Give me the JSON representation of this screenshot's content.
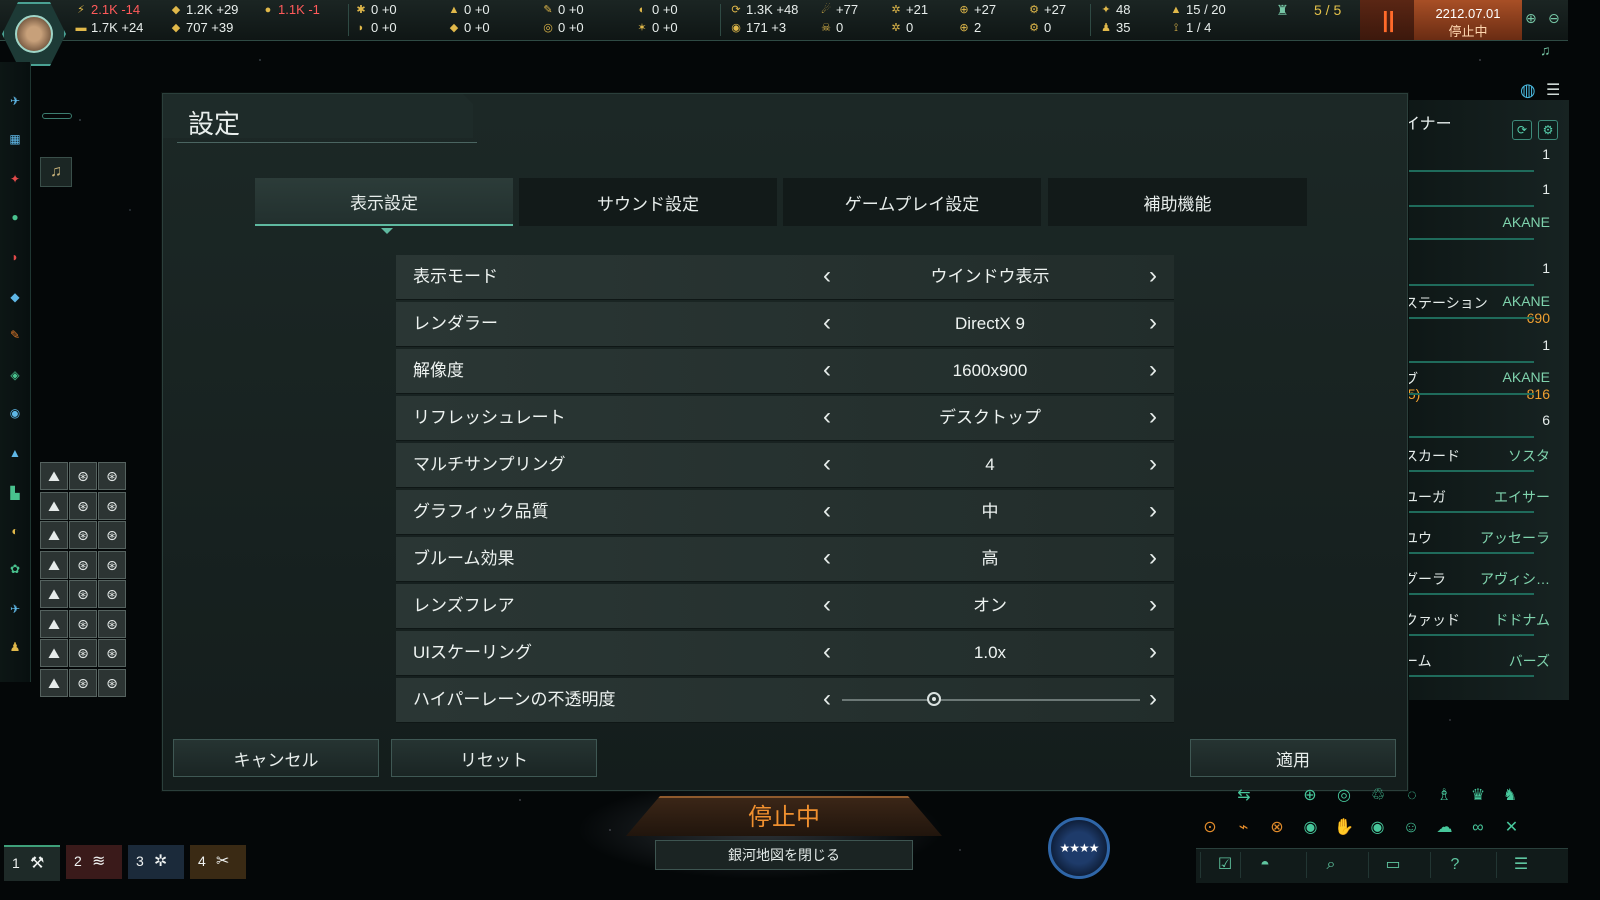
{
  "colors": {
    "accent": "#5fb9a0",
    "energy": "#e0b84a",
    "warning": "#f0902f",
    "negative": "#e24a4a"
  },
  "topbar": {
    "resources_row1": [
      {
        "icon": "energy-icon",
        "glyph": "⚡",
        "text": "2.1K -14",
        "color": "#ff5a5a"
      },
      {
        "icon": "mineral-icon",
        "glyph": "◆",
        "text": "1.2K +29",
        "color": "#e8eeec"
      },
      {
        "icon": "food-icon",
        "glyph": "●",
        "text": "1.1K -1",
        "color": "#ff5a5a"
      },
      {
        "icon": "exotic-gas-icon",
        "glyph": "✱",
        "text": "0 +0",
        "color": "#e8eeec"
      },
      {
        "icon": "crystal-icon",
        "glyph": "▲",
        "text": "0 +0",
        "color": "#e8eeec"
      },
      {
        "icon": "motes-icon",
        "glyph": "✎",
        "text": "0 +0",
        "color": "#e8eeec"
      },
      {
        "icon": "dark-matter-icon",
        "glyph": "◐",
        "text": "0 +0",
        "color": "#e8eeec"
      },
      {
        "icon": "influence-icon",
        "glyph": "⟳",
        "text": "1.3K +48",
        "color": "#e8eeec"
      },
      {
        "icon": "physics-icon",
        "glyph": "☄",
        "text": "+77",
        "color": "#e8eeec"
      },
      {
        "icon": "society-icon",
        "glyph": "✲",
        "text": "+21",
        "color": "#e8eeec"
      },
      {
        "icon": "engineering-icon",
        "glyph": "⊕",
        "text": "+27",
        "color": "#e8eeec"
      },
      {
        "icon": "gear-icon",
        "glyph": "⚙",
        "text": "+27",
        "color": "#e8eeec"
      },
      {
        "icon": "fleet-icon",
        "glyph": "✦",
        "text": "48",
        "color": "#e8eeec"
      },
      {
        "icon": "ship-icon",
        "glyph": "▲",
        "text": "15 / 20",
        "color": "#e8eeec"
      }
    ],
    "resources_row2": [
      {
        "icon": "consumer-goods-icon",
        "glyph": "▬",
        "text": "1.7K +24",
        "color": "#e8eeec"
      },
      {
        "icon": "alloys-icon",
        "glyph": "◆",
        "text": "707 +39",
        "color": "#e8eeec"
      },
      {
        "icon": "nanites-icon",
        "glyph": "◗",
        "text": "0 +0",
        "color": "#e8eeec"
      },
      {
        "icon": "zro-icon",
        "glyph": "◆",
        "text": "0 +0",
        "color": "#e8eeec"
      },
      {
        "icon": "living-metal-icon",
        "glyph": "◎",
        "text": "0 +0",
        "color": "#e8eeec"
      },
      {
        "icon": "sr-dark-icon",
        "glyph": "✶",
        "text": "0 +0",
        "color": "#e8eeec"
      },
      {
        "icon": "unity-icon",
        "glyph": "◉",
        "text": "171 +3",
        "color": "#e8eeec"
      },
      {
        "icon": "skull-icon",
        "glyph": "☠",
        "text": "0",
        "color": "#e8eeec"
      },
      {
        "icon": "atom-icon",
        "glyph": "✲",
        "text": "0",
        "color": "#e8eeec"
      },
      {
        "icon": "globe-icon",
        "glyph": "⊕",
        "text": "2",
        "color": "#e8eeec"
      },
      {
        "icon": "gear-icon",
        "glyph": "⚙",
        "text": "0",
        "color": "#e8eeec"
      },
      {
        "icon": "pop-icon",
        "glyph": "♟",
        "text": "35",
        "color": "#e8eeec"
      },
      {
        "icon": "antenna-icon",
        "glyph": "⟟",
        "text": "1 / 4",
        "color": "#e8eeec"
      }
    ],
    "envoys": "5 / 5",
    "date": "2212.07.01",
    "status": "停止中"
  },
  "dialog": {
    "title": "設定",
    "tabs": [
      "表示設定",
      "サウンド設定",
      "ゲームプレイ設定",
      "補助機能"
    ],
    "active_tab": "表示設定",
    "settings": [
      {
        "label": "表示モード",
        "value": "ウインドウ表示"
      },
      {
        "label": "レンダラー",
        "value": "DirectX 9"
      },
      {
        "label": "解像度",
        "value": "1600x900"
      },
      {
        "label": "リフレッシュレート",
        "value": "デスクトップ"
      },
      {
        "label": "マルチサンプリング",
        "value": "4"
      },
      {
        "label": "グラフィック品質",
        "value": "中"
      },
      {
        "label": "ブルーム効果",
        "value": "高"
      },
      {
        "label": "レンズフレア",
        "value": "オン"
      },
      {
        "label": "UIスケーリング",
        "value": "1.0x"
      },
      {
        "label": "ハイパーレーンの不透明度",
        "value": ""
      }
    ],
    "hyperlane_opacity_fraction": 0.31,
    "buttons": {
      "cancel": "キャンセル",
      "reset": "リセット",
      "apply": "適用"
    }
  },
  "right_panel": {
    "title": "イナー",
    "rows": [
      {
        "left": "",
        "right": "1"
      },
      {
        "left": "",
        "right": "1"
      },
      {
        "left": "",
        "right": "AKANE"
      },
      {
        "left": "",
        "right": "1"
      },
      {
        "left": "ステーション",
        "right": "AKANE",
        "sub": "690"
      },
      {
        "left": "",
        "right": "1"
      },
      {
        "left": "ブ",
        "right": "AKANE",
        "sub": "816",
        "left_sub": ".5)"
      },
      {
        "left": "",
        "right": "6"
      },
      {
        "left": "スカード",
        "right": "ソスタ"
      },
      {
        "left": "ユーガ",
        "right": "エイサー"
      },
      {
        "left": "ユウ",
        "right": "アッセーラ"
      },
      {
        "left": "グーラ",
        "right": "アヴィシ…"
      },
      {
        "left": "クァッド",
        "right": "ドドナム"
      },
      {
        "left": "ーム",
        "right": "バーズ"
      }
    ]
  },
  "bottom": {
    "paused_banner": "停止中",
    "close_galaxy_map": "銀河地図を閉じる",
    "control_groups": [
      "1",
      "2",
      "3",
      "4"
    ]
  }
}
